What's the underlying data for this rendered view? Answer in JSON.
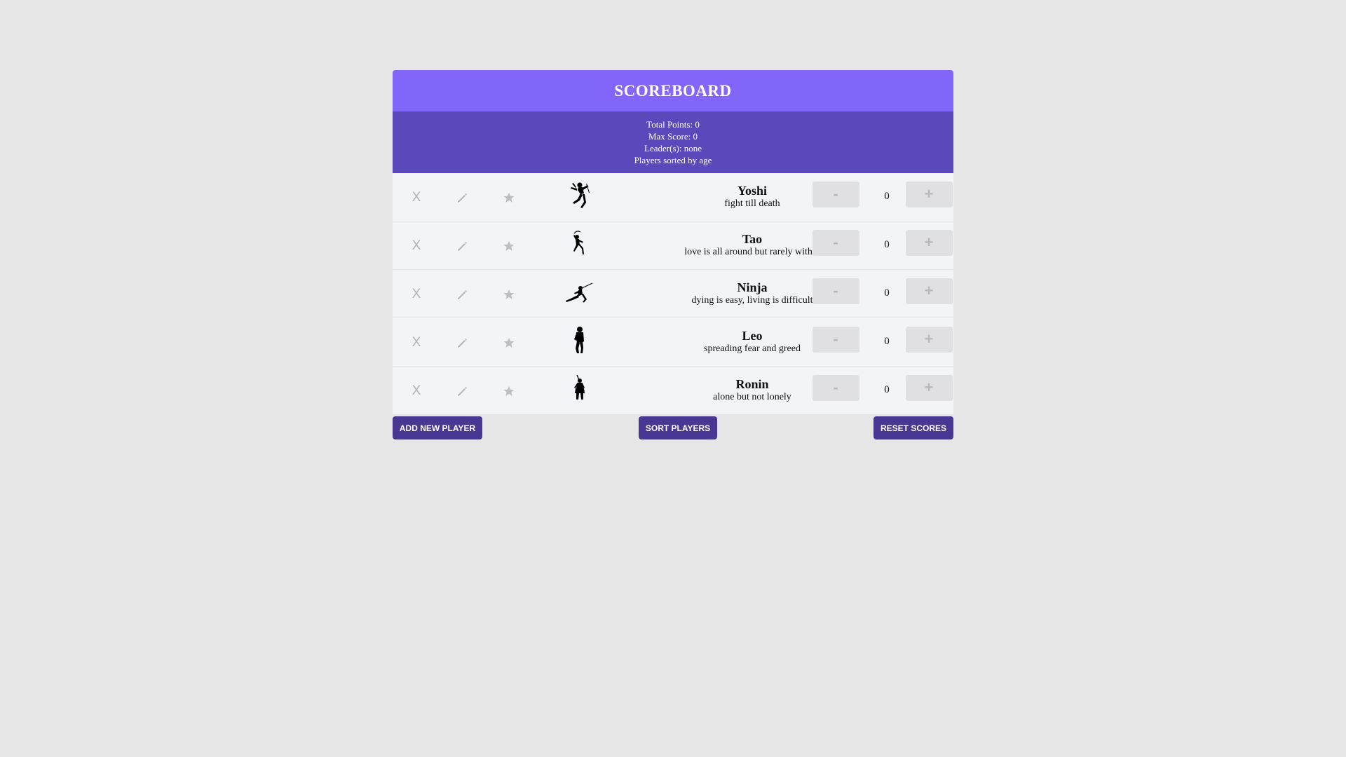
{
  "header": {
    "title": "SCOREBOARD"
  },
  "stats": {
    "total_points": "Total Points: 0",
    "max_score": "Max Score: 0",
    "leaders": "Leader(s): none",
    "sort_info": "Players sorted by age"
  },
  "players": [
    {
      "remove_label": "X",
      "name": "Yoshi",
      "motto": "fight till death",
      "minus_label": "-",
      "score": "0",
      "plus_label": "+",
      "avatar_icon": "ninja-jumping-silhouette-icon"
    },
    {
      "remove_label": "X",
      "name": "Tao",
      "motto": "love is all around but rarely within",
      "minus_label": "-",
      "score": "0",
      "plus_label": "+",
      "avatar_icon": "ninja-sword-raised-silhouette-icon"
    },
    {
      "remove_label": "X",
      "name": "Ninja",
      "motto": "dying is easy, living is difficult",
      "minus_label": "-",
      "score": "0",
      "plus_label": "+",
      "avatar_icon": "ninja-lunging-silhouette-icon"
    },
    {
      "remove_label": "X",
      "name": "Leo",
      "motto": "spreading fear and greed",
      "minus_label": "-",
      "score": "0",
      "plus_label": "+",
      "avatar_icon": "ninja-standing-silhouette-icon"
    },
    {
      "remove_label": "X",
      "name": "Ronin",
      "motto": "alone but not lonely",
      "minus_label": "-",
      "score": "0",
      "plus_label": "+",
      "avatar_icon": "samurai-standing-silhouette-icon"
    }
  ],
  "actions": {
    "add_label": "ADD NEW PLAYER",
    "sort_label": "SORT PLAYERS",
    "reset_label": "RESET SCORES"
  },
  "colors": {
    "header": "#8266fa",
    "stats": "#5b48bb",
    "action_button": "#483894",
    "page_background": "#e6e6e6"
  }
}
